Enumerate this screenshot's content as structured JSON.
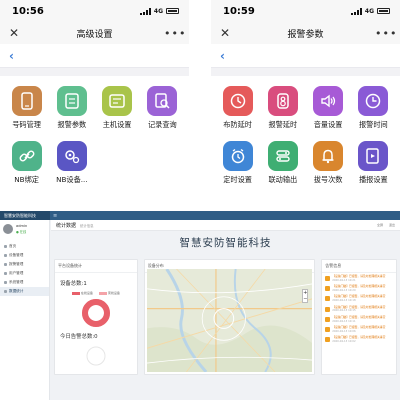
{
  "phone_left": {
    "time": "10:56",
    "network": "4G",
    "nav_title": "高级设置",
    "tiles": [
      {
        "label": "号码管理",
        "icon": "phone-manage-icon",
        "color": "#c9864a"
      },
      {
        "label": "报警参数",
        "icon": "alarm-params-icon",
        "color": "#5fbf8f"
      },
      {
        "label": "主机设置",
        "icon": "host-settings-icon",
        "color": "#a9c44a"
      },
      {
        "label": "记录查询",
        "icon": "record-search-icon",
        "color": "#9b63d6"
      },
      {
        "label": "NB绑定",
        "icon": "nb-bind-icon",
        "color": "#4fb38a"
      },
      {
        "label": "NB设备...",
        "icon": "nb-device-icon",
        "color": "#5a56c4"
      }
    ]
  },
  "phone_right": {
    "time": "10:59",
    "network": "4G",
    "nav_title": "报警参数",
    "tiles": [
      {
        "label": "布防延时",
        "icon": "arm-delay-icon",
        "color": "#e55a5a"
      },
      {
        "label": "报警延时",
        "icon": "alarm-delay-icon",
        "color": "#d94d7e"
      },
      {
        "label": "音量设置",
        "icon": "volume-icon",
        "color": "#a75ad6"
      },
      {
        "label": "报警时间",
        "icon": "alarm-time-icon",
        "color": "#8a5ad6"
      },
      {
        "label": "定时设置",
        "icon": "timer-icon",
        "color": "#3f86d6"
      },
      {
        "label": "联动输出",
        "icon": "linkage-output-icon",
        "color": "#3fae73"
      },
      {
        "label": "拔号次数",
        "icon": "dial-count-icon",
        "color": "#d9862e"
      },
      {
        "label": "播报设置",
        "icon": "broadcast-icon",
        "color": "#6a55c9"
      }
    ]
  },
  "web": {
    "brand": "智慧安防智能科技",
    "user": {
      "name": "admin",
      "status": "● 在线"
    },
    "nav": [
      {
        "label": "首页"
      },
      {
        "label": "设备管理"
      },
      {
        "label": "报警管理"
      },
      {
        "label": "用户管理"
      },
      {
        "label": "系统管理"
      },
      {
        "label": "数据统计"
      }
    ],
    "page_title": "统计数据",
    "page_sub": "统计信息",
    "tools": [
      "全屏",
      "退出"
    ],
    "big_title": "智慧安防智能科技",
    "card_devices": {
      "title": "平台设备统计",
      "device_total": "设备总数:1",
      "legend": [
        "在线设备",
        "离线设备"
      ],
      "today_alarms": "今日告警总数:0"
    },
    "card_map": {
      "title": "设备分布",
      "zoom_in": "+",
      "zoom_out": "−"
    },
    "card_alerts": {
      "title": "告警信息",
      "items": [
        {
          "text": "【设备门磁】已报警，请及时处理相关事宜",
          "time": "2020-04-13 10:21"
        },
        {
          "text": "【设备门磁】已报警，请及时处理相关事宜",
          "time": "2020-04-13 10:20"
        },
        {
          "text": "【设备门磁】已报警，请及时处理相关事宜",
          "time": "2020-04-13 10:18"
        },
        {
          "text": "【设备门磁】已报警，请及时处理相关事宜",
          "time": "2020-04-13 10:15"
        },
        {
          "text": "【设备门磁】已报警，请及时处理相关事宜",
          "time": "2020-04-13 10:11"
        },
        {
          "text": "【设备门磁】已报警，请及时处理相关事宜",
          "time": "2020-04-13 10:06"
        },
        {
          "text": "【设备门磁】已报警，请及时处理相关事宜",
          "time": "2020-04-13 10:02"
        }
      ]
    },
    "online_fraction": 1.0
  }
}
